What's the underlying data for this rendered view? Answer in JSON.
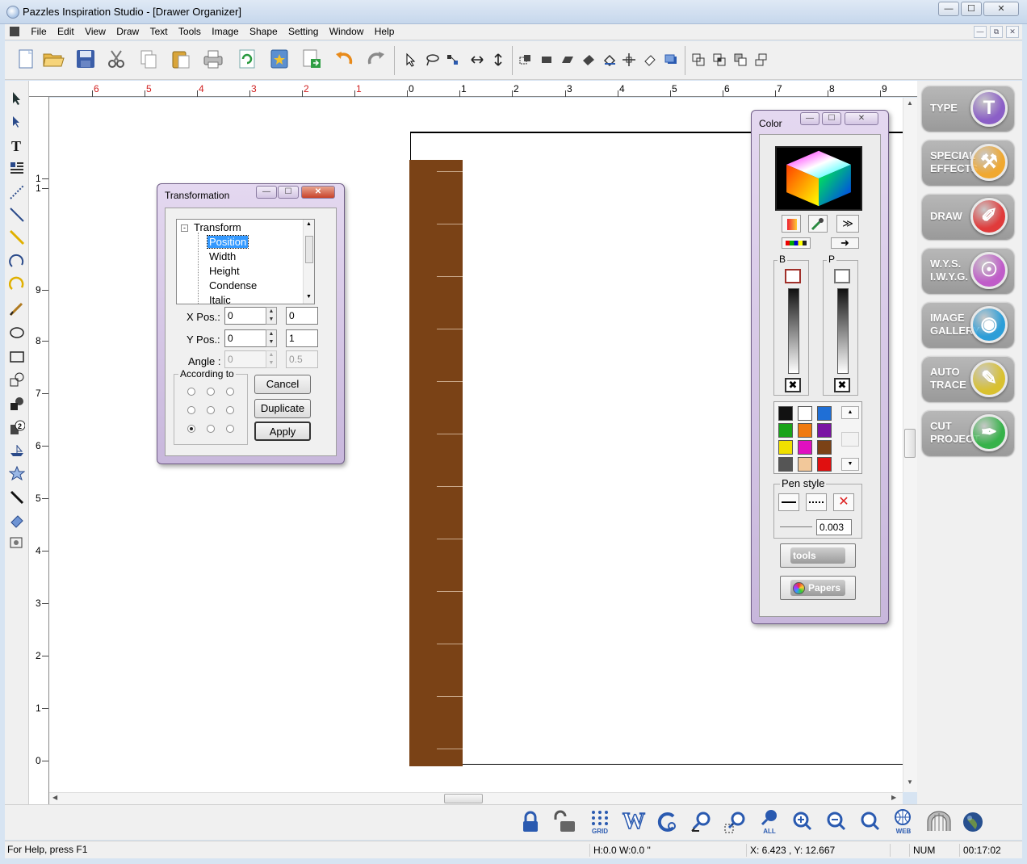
{
  "window": {
    "title": "Pazzles Inspiration Studio - [Drawer Organizer]",
    "controls": [
      "—",
      "☐",
      "✕"
    ]
  },
  "menu": {
    "items": [
      "File",
      "Edit",
      "View",
      "Draw",
      "Text",
      "Tools",
      "Image",
      "Shape",
      "Setting",
      "Window",
      "Help"
    ]
  },
  "rulers": {
    "horizontal": [
      "6",
      "5",
      "4",
      "3",
      "2",
      "1",
      "0",
      "1",
      "2",
      "3",
      "4",
      "5",
      "6",
      "7",
      "8",
      "9"
    ],
    "vertical": [
      "1",
      "1",
      "9",
      "8",
      "7",
      "6",
      "5",
      "4",
      "3",
      "2",
      "1",
      "0"
    ]
  },
  "transformation": {
    "title": "Transformation",
    "tree_root": "Transform",
    "tree_items": [
      "Position",
      "Width",
      "Height",
      "Condense",
      "Italic"
    ],
    "selected_item": "Position",
    "xpos_label": "X Pos.:",
    "xpos_value": "0",
    "xpos_value2": "0",
    "ypos_label": "Y Pos.:",
    "ypos_value": "0",
    "ypos_value2": "1",
    "angle_label": "Angle :",
    "angle_value": "0",
    "angle_value2": "0.5",
    "according_label": "According to",
    "cancel": "Cancel",
    "duplicate": "Duplicate",
    "apply": "Apply",
    "selected_anchor": "bottom-left"
  },
  "color_panel": {
    "title": "Color",
    "b_label": "B",
    "p_label": "P",
    "swatches": [
      "#111111",
      "#ffffff",
      "#1f6fd6",
      "#19a319",
      "#f07a10",
      "#7a13a3",
      "#f0e000",
      "#e010c0",
      "#7b4216",
      "#555555",
      "#f2c89a",
      "#e01010"
    ],
    "pen_style_label": "Pen style",
    "pen_width": "0.003",
    "tools_label": "tools",
    "papers_label": "Papers"
  },
  "right_panel": {
    "buttons": [
      {
        "label_line1": "TYPE",
        "label_line2": "",
        "icon": "type-icon",
        "color": "#8b5fc7"
      },
      {
        "label_line1": "SPECIAL",
        "label_line2": "EFFECTS",
        "icon": "hammer-icon",
        "color": "#f0a830"
      },
      {
        "label_line1": "DRAW",
        "label_line2": "",
        "icon": "pen-icon",
        "color": "#e03b3b"
      },
      {
        "label_line1": "W.Y.S.",
        "label_line2": "I.W.Y.G.",
        "icon": "binoculars-icon",
        "color": "#c05cc9"
      },
      {
        "label_line1": "IMAGE",
        "label_line2": "GALLERY",
        "icon": "eye-icon",
        "color": "#2c9ed8"
      },
      {
        "label_line1": "AUTO",
        "label_line2": "TRACE",
        "icon": "trace-pen-icon",
        "color": "#d9c130"
      },
      {
        "label_line1": "CUT",
        "label_line2": "PROJECT",
        "icon": "cut-pen-icon",
        "color": "#37b24a"
      }
    ]
  },
  "bottom_toolbar": {
    "grid_label": "GRID",
    "w_label": "W",
    "all_label": "ALL",
    "web_label": "WEB"
  },
  "status": {
    "help": "For Help, press F1",
    "hw": "H:0.0   W:0.0 \"",
    "coords": "X: 6.423 , Y: 12.667",
    "num": "NUM",
    "time": "00:17:02"
  },
  "canvas": {
    "strip_color": "#7a4216"
  }
}
